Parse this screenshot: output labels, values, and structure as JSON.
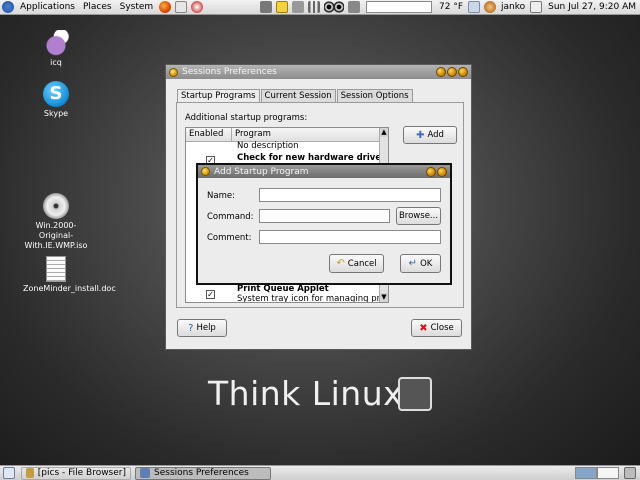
{
  "top_panel": {
    "menus": [
      "Applications",
      "Places",
      "System"
    ],
    "weather": "72 °F",
    "user": "janko",
    "clock": "Sun Jul 27,  9:20 AM"
  },
  "desktop": {
    "icons": [
      {
        "label": "icq",
        "icon": "icq-flower-icon"
      },
      {
        "label": "Skype",
        "icon": "skype-icon"
      },
      {
        "label": "Win.2000-Original-With.IE.WMP.iso",
        "icon": "disc-image-icon"
      },
      {
        "label": "ZoneMinder_install.doc",
        "icon": "document-icon"
      }
    ],
    "wallpaper_text": "Think Linux"
  },
  "sessions_window": {
    "title": "Sessions Preferences",
    "tabs": [
      "Startup Programs",
      "Current Session",
      "Session Options"
    ],
    "section_label": "Additional startup programs:",
    "columns": [
      "Enabled",
      "Program"
    ],
    "rows": [
      {
        "desc": "No description"
      },
      {
        "name": "Check for new hardware drive...",
        "enabled": true
      },
      {
        "name": "Print Queue Applet",
        "desc": "System tray icon for managing pri...",
        "enabled": true
      }
    ],
    "add_label": "Add",
    "help_label": "Help",
    "close_label": "Close"
  },
  "add_dialog": {
    "title": "Add Startup Program",
    "name_label": "Name:",
    "command_label": "Command:",
    "comment_label": "Comment:",
    "browse_label": "Browse...",
    "cancel_label": "Cancel",
    "ok_label": "OK",
    "name_value": "",
    "command_value": "",
    "comment_value": ""
  },
  "bottom_panel": {
    "tasks": [
      "[pics - File Browser]",
      "Sessions Preferences"
    ]
  },
  "colors": {
    "accent_blue": "#86a3c8",
    "title_gold": "#d79200"
  }
}
